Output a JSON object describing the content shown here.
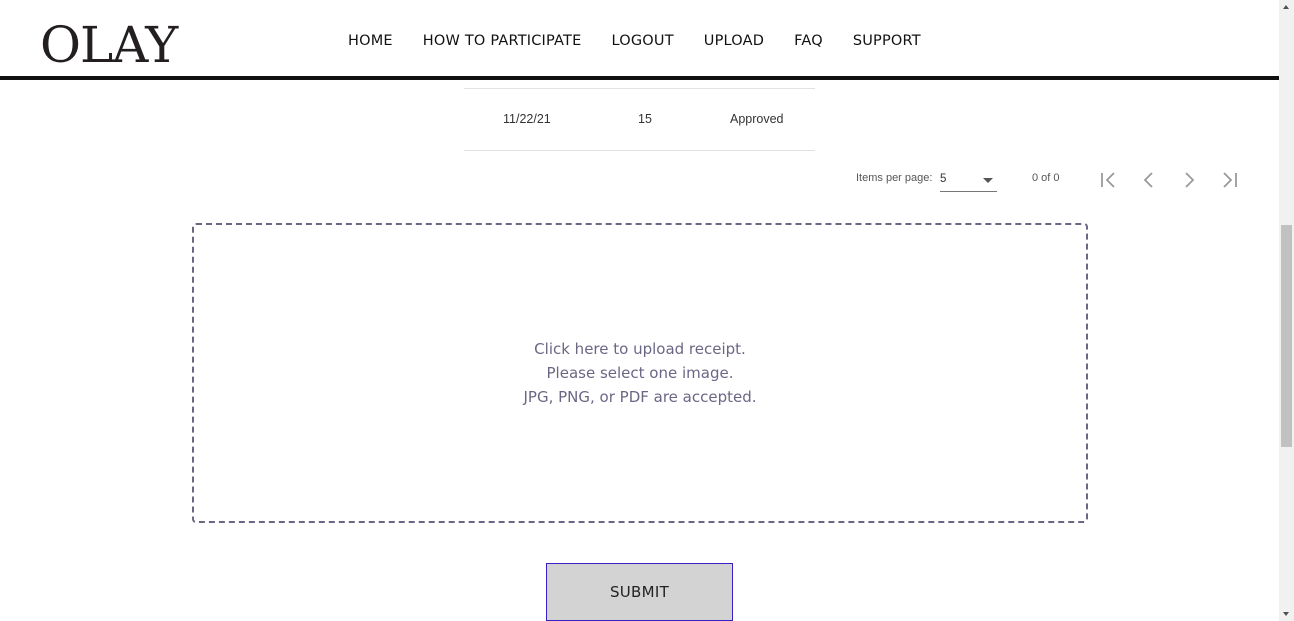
{
  "header": {
    "logo": "OLAY",
    "nav": [
      "HOME",
      "HOW TO PARTICIPATE",
      "LOGOUT",
      "UPLOAD",
      "FAQ",
      "SUPPORT"
    ]
  },
  "table": {
    "row": {
      "date": "11/22/21",
      "quantity": "15",
      "status": "Approved"
    }
  },
  "paginator": {
    "items_per_page_label": "Items per page:",
    "items_per_page_value": "5",
    "range_label": "0 of 0",
    "icons": [
      "first-page-icon",
      "previous-page-icon",
      "next-page-icon",
      "last-page-icon"
    ]
  },
  "upload": {
    "line1": "Click here to upload receipt.",
    "line2": "Please select one image.",
    "line3": "JPG, PNG, or PDF are accepted."
  },
  "submit_label": "SUBMIT",
  "colors": {
    "upload_border": "#6a6785",
    "submit_border": "#3a1fc7",
    "submit_bg": "#d3d3d3",
    "header_rule": "#111111"
  }
}
